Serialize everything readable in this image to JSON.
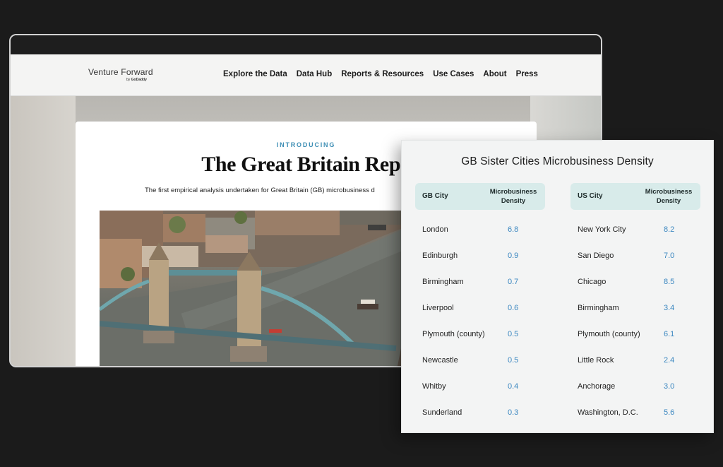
{
  "site": {
    "logo_main": "Venture Forward",
    "logo_by": "by",
    "logo_brand": "GoDaddy",
    "nav": [
      {
        "label": "Explore the Data"
      },
      {
        "label": "Data Hub"
      },
      {
        "label": "Reports & Resources"
      },
      {
        "label": "Use Cases"
      },
      {
        "label": "About"
      },
      {
        "label": "Press"
      }
    ]
  },
  "hero": {
    "eyebrow": "INTRODUCING",
    "title": "The Great Britain Repo",
    "subtitle": "The first empirical analysis undertaken for Great Britain (GB) microbusiness d"
  },
  "table": {
    "title": "GB Sister Cities Microbusiness Density",
    "gb_header": {
      "city": "GB City",
      "density_line1": "Microbusiness",
      "density_line2": "Density"
    },
    "us_header": {
      "city": "US City",
      "density_line1": "Microbusiness",
      "density_line2": "Density"
    },
    "gb_rows": [
      {
        "city": "London",
        "density": "6.8"
      },
      {
        "city": "Edinburgh",
        "density": "0.9"
      },
      {
        "city": "Birmingham",
        "density": "0.7"
      },
      {
        "city": "Liverpool",
        "density": "0.6"
      },
      {
        "city": "Plymouth (county)",
        "density": "0.5"
      },
      {
        "city": "Newcastle",
        "density": "0.5"
      },
      {
        "city": "Whitby",
        "density": "0.4"
      },
      {
        "city": "Sunderland",
        "density": "0.3"
      }
    ],
    "us_rows": [
      {
        "city": "New York City",
        "density": "8.2"
      },
      {
        "city": "San Diego",
        "density": "7.0"
      },
      {
        "city": "Chicago",
        "density": "8.5"
      },
      {
        "city": "Birmingham",
        "density": "3.4"
      },
      {
        "city": "Plymouth (county)",
        "density": "6.1"
      },
      {
        "city": "Little Rock",
        "density": "2.4"
      },
      {
        "city": "Anchorage",
        "density": "3.0"
      },
      {
        "city": "Washington, D.C.",
        "density": "5.6"
      }
    ]
  },
  "colors": {
    "background": "#1b1b1b",
    "accent": "#3f8fb5",
    "value_blue": "#3b87c0",
    "header_teal": "#d8ebea"
  }
}
